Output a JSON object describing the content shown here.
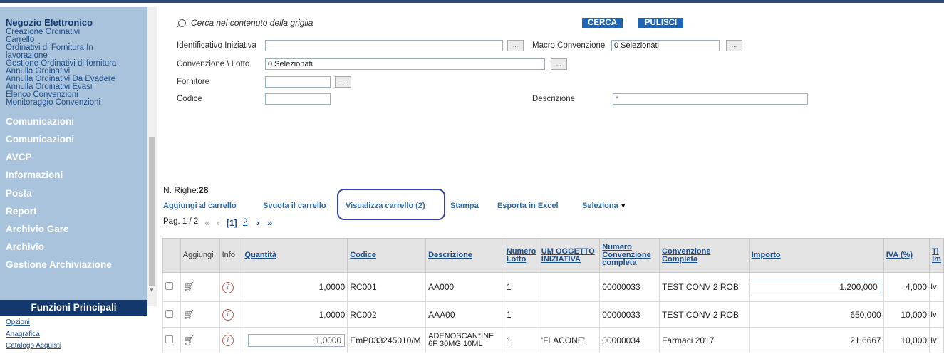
{
  "sidebar": {
    "header": "Negozio Elettronico",
    "subitems": [
      "Creazione Ordinativi",
      "Carrello",
      "Ordinativi di Fornitura In",
      "lavorazione",
      "Gestione Ordinativi di fornitura",
      "Annulla Ordinativi",
      "Annulla Ordinativi Da Evadere",
      "Annulla Ordinativi Evasi",
      "Elenco Convenzioni",
      "Monitoraggio Convenzioni"
    ],
    "sections": [
      "Comunicazioni",
      "Comunicazioni",
      "AVCP",
      "Informazioni",
      "Posta",
      "Report",
      "Archivio Gare",
      "Archivio",
      "Gestione Archiviazione"
    ],
    "funzioni_title": "Funzioni Principali",
    "links": [
      "Opzioni",
      "Anagrafica",
      "Catalogo Acquisti"
    ]
  },
  "search": {
    "label": "Cerca nel contenuto della griglia",
    "cerca_label": "CERCA",
    "pulisci_label": "PULISCI",
    "identificativo_label": "Identificativo Iniziativa",
    "identificativo_value": "",
    "macro_label": "Macro Convenzione",
    "macro_value": "0 Selezionati",
    "convenzione_label": "Convenzione \\ Lotto",
    "convenzione_value": "0 Selezionati",
    "fornitore_label": "Fornitore",
    "fornitore_value": "",
    "codice_label": "Codice",
    "codice_value": "",
    "descrizione_label": "Descrizione",
    "descrizione_value": "*",
    "dots": "..."
  },
  "toolbar": {
    "nrighe_label": "N. Righe:",
    "nrighe_value": "28",
    "aggiungi": "Aggiungi al carrello",
    "svuota": "Svuota il carrello",
    "visualizza": "Visualizza carrello (2)",
    "stampa": "Stampa",
    "esporta": "Esporta in Excel",
    "seleziona": "Seleziona",
    "pag_label": "Pag. 1 / 2",
    "page_current": "[1]",
    "page_next": "2"
  },
  "grid": {
    "headers": [
      "Aggiungi",
      "Info",
      "Quantità",
      "Codice",
      "Descrizione",
      "Numero Lotto",
      "UM OGGETTO INIZIATIVA",
      "Numero Convenzione completa",
      "Convenzione Completa",
      "Importo",
      "IVA (%)",
      "Ti Im"
    ],
    "rows": [
      {
        "quantita": "1,0000",
        "codice": "RC001",
        "descrizione": "AA000",
        "lotto": "1",
        "um": "",
        "numconv": "00000033",
        "conv": "TEST CONV 2 ROB",
        "importo": "1.200,000",
        "iva": "4,000",
        "ti": "Iv"
      },
      {
        "quantita": "1,0000",
        "codice": "RC002",
        "descrizione": "AAA00",
        "lotto": "1",
        "um": "",
        "numconv": "00000033",
        "conv": "TEST CONV 2 ROB",
        "importo": "650,000",
        "iva": "10,000",
        "ti": "Iv"
      },
      {
        "quantita": "1,0000",
        "codice": "EmP033245010/M",
        "descrizione": "ADENOSCAN*INF 6F 30MG 10ML",
        "lotto": "1",
        "um": "'FLACONE'",
        "numconv": "00000034",
        "conv": "Farmaci 2017",
        "importo": "21,6667",
        "iva": "10,000",
        "ti": "Iv"
      }
    ]
  },
  "colors": {
    "sidebar_bg": "#a9c3dd",
    "funzioni_bg": "#13386e",
    "button_blue": "#1f65b3",
    "link_blue": "#2f6aa8",
    "highlight": "#3a3fb0"
  }
}
